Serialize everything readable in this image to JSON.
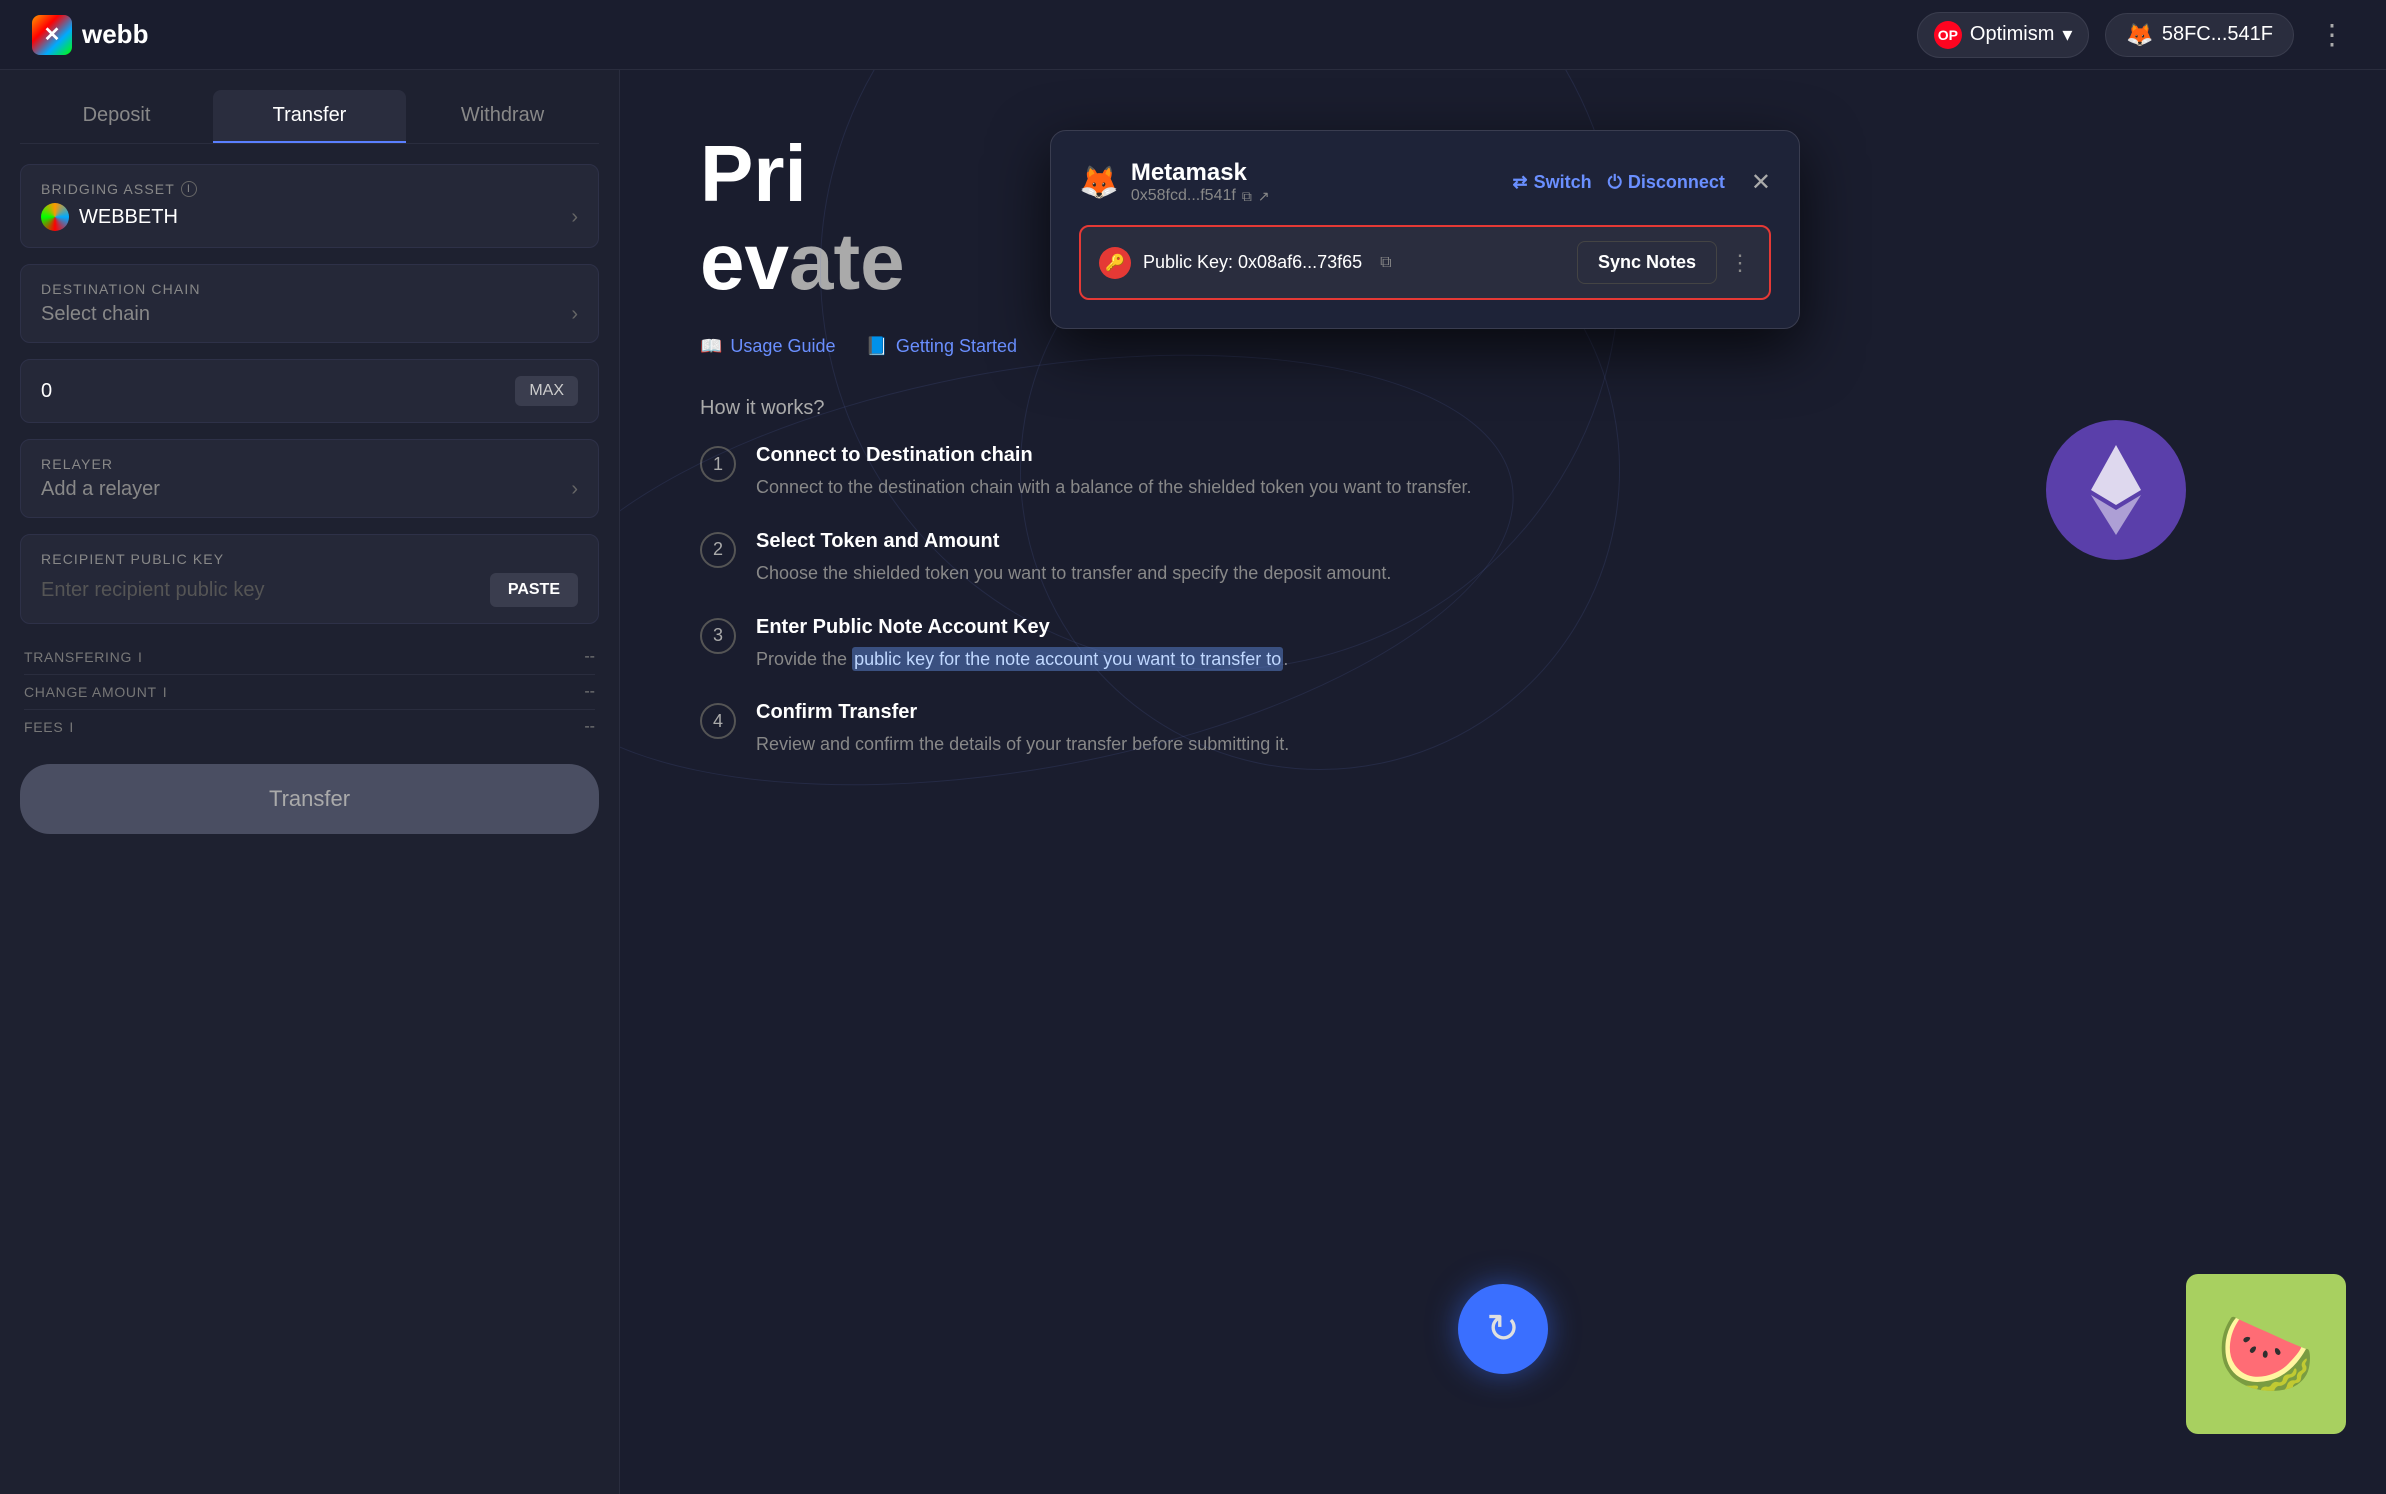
{
  "app": {
    "name": "webb",
    "logo_emoji": "✕"
  },
  "header": {
    "network": {
      "name": "Optimism",
      "icon": "OP"
    },
    "wallet": {
      "address": "58FC...541F",
      "emoji": "🦊"
    },
    "more_label": "⋮"
  },
  "tabs": {
    "items": [
      {
        "label": "Deposit",
        "active": false
      },
      {
        "label": "Transfer",
        "active": true
      },
      {
        "label": "Withdraw",
        "active": false
      }
    ]
  },
  "form": {
    "bridging_asset": {
      "label": "BRIDGING ASSET",
      "value": "WEBBETH"
    },
    "destination_chain": {
      "label": "DESTINATION CHAIN",
      "placeholder": "Select chain"
    },
    "amount": {
      "value": "0",
      "max_label": "MAX"
    },
    "relayer": {
      "label": "RELAYER",
      "placeholder": "Add a relayer"
    },
    "recipient_public_key": {
      "label": "RECIPIENT PUBLIC KEY",
      "placeholder": "Enter recipient public key",
      "paste_label": "PASTE"
    },
    "stats": {
      "transfering": {
        "label": "TRANSFERING",
        "value": "--"
      },
      "change_amount": {
        "label": "CHANGE AMOUNT",
        "value": "--"
      },
      "fees": {
        "label": "FEES",
        "value": "--"
      }
    },
    "transfer_btn": "Transfer"
  },
  "right_panel": {
    "title_line1": "Pri",
    "title_line2": "ev",
    "tagline": "vate",
    "guide_links": [
      {
        "label": "Usage Guide",
        "icon": "📖"
      },
      {
        "label": "Getting Started",
        "icon": "📘"
      }
    ],
    "how_it_works": "How it works?",
    "steps": [
      {
        "num": "1",
        "title": "Connect to Destination chain",
        "desc": "Connect to the destination chain with a balance of the shielded token you want to transfer."
      },
      {
        "num": "2",
        "title": "Select Token and Amount",
        "desc": "Choose the shielded token you want to transfer and specify the deposit amount."
      },
      {
        "num": "3",
        "title": "Enter Public Note Account Key",
        "desc_normal": "Provide the ",
        "desc_highlight": "public key for the note account you want to transfer to",
        "desc_end": "."
      },
      {
        "num": "4",
        "title": "Confirm Transfer",
        "desc": "Review and confirm the details of your transfer before submitting it."
      }
    ]
  },
  "metamask_popup": {
    "wallet_name": "Metamask",
    "wallet_address": "0x58fcd...f541f",
    "switch_label": "Switch",
    "disconnect_label": "Disconnect",
    "public_key_label": "Public Key: 0x08af6...73f65",
    "sync_notes_label": "Sync Notes",
    "more_label": "⋮",
    "close_label": "✕"
  }
}
